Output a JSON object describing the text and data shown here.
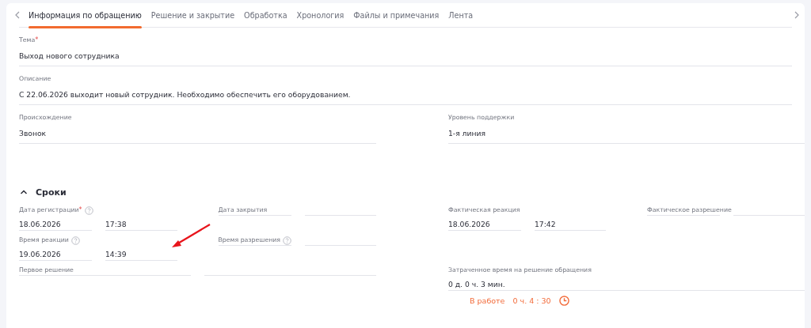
{
  "tabs": [
    {
      "label": "Информация по обращению",
      "selected": true
    },
    {
      "label": "Решение и закрытие",
      "selected": false
    },
    {
      "label": "Обработка",
      "selected": false
    },
    {
      "label": "Хронология",
      "selected": false
    },
    {
      "label": "Файлы и примечания",
      "selected": false
    },
    {
      "label": "Лента",
      "selected": false
    }
  ],
  "fields": [
    {
      "label": "Тема",
      "required_mark": "*",
      "value": "Выход нового сотрудника"
    },
    {
      "label": "Описание",
      "value": "С 22.06.2026 выходит новый сотрудник. Необходимо обеспечить его оборудованием."
    }
  ],
  "pairs": [
    {
      "label": "Происхождение",
      "value": "Звонок"
    },
    {
      "label": "Уровень поддержки",
      "value": "1-я линия"
    }
  ],
  "section": {
    "title": "Сроки",
    "expanded": true
  },
  "timing": [
    {
      "kind": "quad",
      "items": [
        {
          "kind": "datetime",
          "label": "Дата регистрации",
          "required_mark": "*",
          "help": true,
          "date": "18.06.2026",
          "time": "17:38"
        },
        {
          "kind": "datetime",
          "label": "Дата закрытия",
          "help": false
        },
        {
          "kind": "datetime",
          "label": "Фактическая реакция",
          "help": false,
          "date": "18.06.2026",
          "time": "17:42"
        },
        {
          "kind": "datetime",
          "label": "Фактическое разрешение",
          "help": false
        }
      ]
    },
    {
      "kind": "quad",
      "items": [
        {
          "kind": "datetime",
          "label": "Время реакции",
          "help": true,
          "date": "19.06.2026",
          "time": "14:39"
        },
        {
          "kind": "datetime",
          "label": "Время разрешения",
          "help": true
        }
      ]
    },
    {
      "kind": "wide",
      "items": [
        {
          "kind": "split",
          "label": "Первое решение",
          "help": false
        },
        {
          "kind": "text",
          "label": "Затраченное время на решение обращения",
          "help": false,
          "value": "0 д. 0 ч. 3 мин."
        }
      ]
    }
  ],
  "status": {
    "label": "В работе",
    "timer": "0 ч. 4 : 30"
  }
}
